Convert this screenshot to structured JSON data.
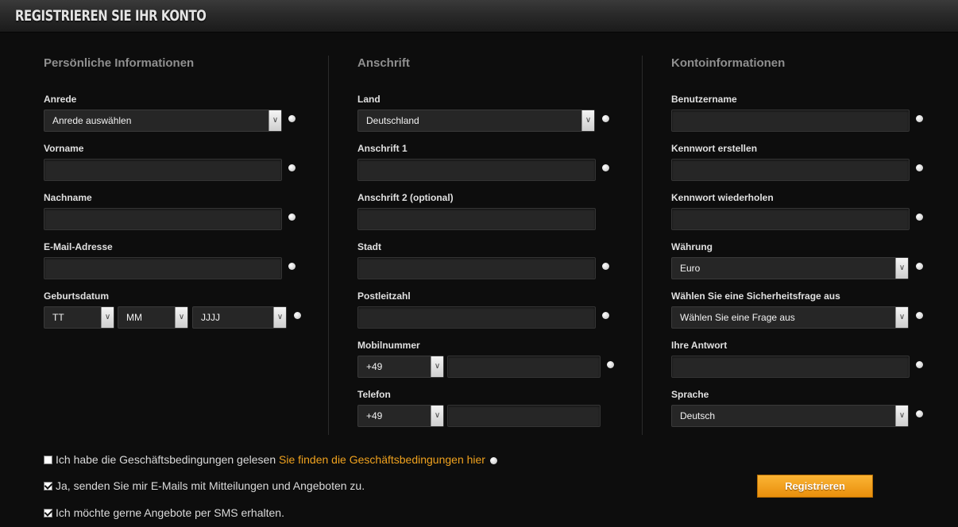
{
  "page": {
    "title": "Registrieren Sie Ihr Konto"
  },
  "personal": {
    "heading": "Persönliche Informationen",
    "salutation_label": "Anrede",
    "salutation_value": "Anrede auswählen",
    "firstname_label": "Vorname",
    "lastname_label": "Nachname",
    "email_label": "E-Mail-Adresse",
    "birthdate_label": "Geburtsdatum",
    "birth_day": "TT",
    "birth_month": "MM",
    "birth_year": "JJJJ"
  },
  "address": {
    "heading": "Anschrift",
    "country_label": "Land",
    "country_value": "Deutschland",
    "address1_label": "Anschrift 1",
    "address2_label": "Anschrift 2 (optional)",
    "city_label": "Stadt",
    "zip_label": "Postleitzahl",
    "mobile_label": "Mobilnummer",
    "mobile_prefix": "+49",
    "phone_label": "Telefon",
    "phone_prefix": "+49"
  },
  "account": {
    "heading": "Kontoinformationen",
    "username_label": "Benutzername",
    "password_label": "Kennwort erstellen",
    "password_repeat_label": "Kennwort wiederholen",
    "currency_label": "Währung",
    "currency_value": "Euro",
    "security_question_label": "Wählen Sie eine Sicherheitsfrage aus",
    "security_question_value": "Wählen Sie eine Frage aus",
    "answer_label": "Ihre Antwort",
    "language_label": "Sprache",
    "language_value": "Deutsch"
  },
  "consents": {
    "terms_text": "Ich habe die Geschäftsbedingungen gelesen",
    "terms_link": "Sie finden die Geschäftsbedingungen hier",
    "terms_checked": false,
    "email_text": "Ja, senden Sie mir E-Mails mit Mitteilungen und Angeboten zu.",
    "email_checked": true,
    "sms_text": "Ich möchte gerne Angebote per SMS erhalten.",
    "sms_checked": true
  },
  "actions": {
    "register_label": "Registrieren"
  },
  "colors": {
    "accent": "#f0a21e",
    "background": "#0d0d0d",
    "field": "#262626"
  },
  "icons": {
    "field_status": "info-dot-icon",
    "dropdown": "chevron-down-icon",
    "checkbox": "checkmark-icon"
  }
}
